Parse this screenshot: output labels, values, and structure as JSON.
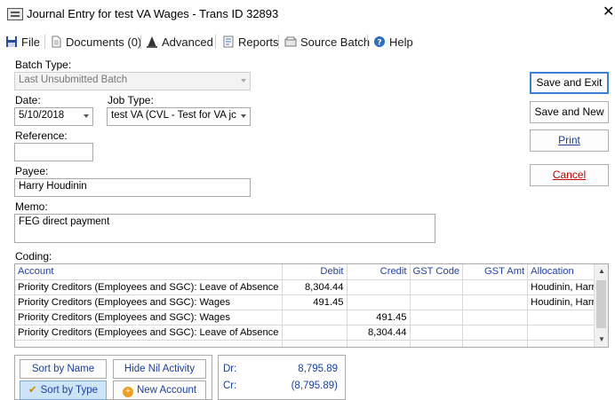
{
  "window": {
    "title": "Journal Entry for test VA Wages - Trans ID 32893",
    "close_glyph": "✕"
  },
  "menu": [
    {
      "label": "File",
      "icon": "save-disk-icon"
    },
    {
      "label": "Documents (0)",
      "icon": "document-icon"
    },
    {
      "label": "Advanced",
      "icon": "wizard-hat-icon"
    },
    {
      "label": "Reports",
      "icon": "report-icon"
    },
    {
      "label": "Source Batch",
      "icon": "batch-icon"
    },
    {
      "label": "Help",
      "icon": "help-icon"
    }
  ],
  "form": {
    "batch_type_label": "Batch Type:",
    "batch_type_value": "Last Unsubmitted Batch",
    "date_label": "Date:",
    "date_value": "5/10/2018",
    "job_type_label": "Job Type:",
    "job_type_value": "test VA (CVL - Test for VA jc",
    "reference_label": "Reference:",
    "reference_value": "",
    "payee_label": "Payee:",
    "payee_value": "Harry Houdinin",
    "memo_label": "Memo:",
    "memo_value": "FEG direct payment",
    "coding_label": "Coding:"
  },
  "buttons": {
    "save_exit": "Save and Exit",
    "save_new": "Save and New",
    "print": "Print",
    "cancel": "Cancel"
  },
  "coding": {
    "columns": [
      "Account",
      "Debit",
      "Credit",
      "GST Code",
      "GST Amt",
      "Allocation"
    ],
    "rows": [
      {
        "account": "Priority Creditors (Employees and SGC): Leave of Absence",
        "debit": "8,304.44",
        "credit": "",
        "gst_code": "",
        "gst_amt": "",
        "allocation": "Houdinin, Harry"
      },
      {
        "account": "Priority Creditors (Employees and SGC): Wages",
        "debit": "491.45",
        "credit": "",
        "gst_code": "",
        "gst_amt": "",
        "allocation": "Houdinin, Harry"
      },
      {
        "account": "Priority Creditors (Employees and SGC): Wages",
        "debit": "",
        "credit": "491.45",
        "gst_code": "",
        "gst_amt": "",
        "allocation": ""
      },
      {
        "account": "Priority Creditors (Employees and SGC): Leave of Absence",
        "debit": "",
        "credit": "8,304.44",
        "gst_code": "",
        "gst_amt": "",
        "allocation": ""
      }
    ]
  },
  "bottom": {
    "sort_by_name": "Sort by Name",
    "sort_by_type": "Sort by Type",
    "hide_nil": "Hide Nil Activity",
    "new_account": "New Account",
    "dr_label": "Dr:",
    "dr_value": "8,795.89",
    "cr_label": "Cr:",
    "cr_value": "(8,795.89)"
  },
  "colors": {
    "accent_blue": "#2543a8",
    "cancel_red": "#c00000",
    "active_sort": "#cde4f7"
  }
}
